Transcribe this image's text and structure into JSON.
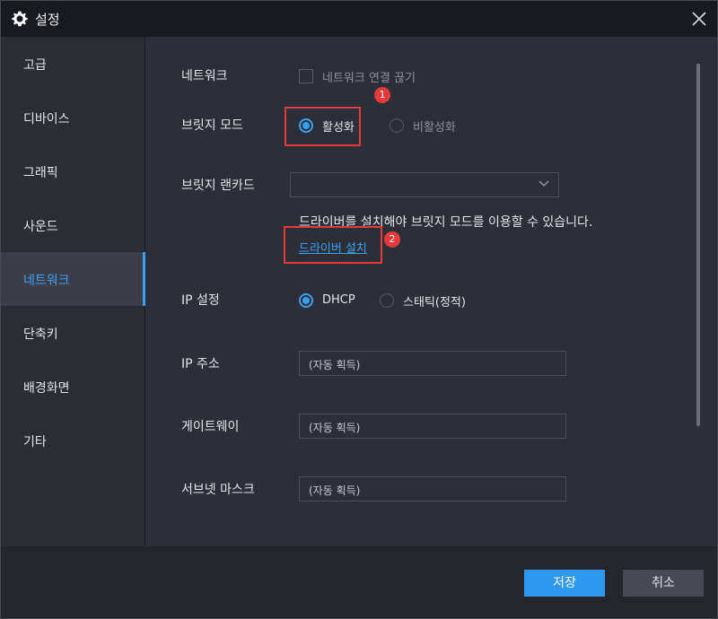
{
  "window": {
    "title": "설정"
  },
  "sidebar": {
    "items": [
      {
        "label": "고급"
      },
      {
        "label": "디바이스"
      },
      {
        "label": "그래픽"
      },
      {
        "label": "사운드"
      },
      {
        "label": "네트워크",
        "active": true
      },
      {
        "label": "단축키"
      },
      {
        "label": "배경화면"
      },
      {
        "label": "기타"
      }
    ]
  },
  "network": {
    "network_label": "네트워크",
    "disconnect_checkbox_label": "네트워크 연결 끊기",
    "disconnect_checked": false,
    "bridge_mode_label": "브릿지 모드",
    "bridge_enable_label": "활성화",
    "bridge_disable_label": "비활성화",
    "bridge_mode_selected": "활성화",
    "bridge_lancard_label": "브릿지 랜카드",
    "bridge_lancard_value": "",
    "driver_notice": "드라이버를 설치해야 브릿지 모드를 이용할 수 있습니다.",
    "driver_install_link": "드라이버 설치",
    "ip_settings_label": "IP 설정",
    "ip_dhcp_label": "DHCP",
    "ip_static_label": "스태틱(정적)",
    "ip_mode_selected": "DHCP",
    "ip_address_label": "IP 주소",
    "ip_address_value": "(자동 획득)",
    "gateway_label": "게이트웨이",
    "gateway_value": "(자동 획득)",
    "subnet_label": "서브넷 마스크",
    "subnet_value": "(자동 획득)"
  },
  "annotations": {
    "badge1": "1",
    "badge2": "2",
    "highlight_color": "#e43c3c"
  },
  "footer": {
    "save_label": "저장",
    "cancel_label": "취소"
  },
  "colors": {
    "accent": "#3aa0f5",
    "save_button": "#2e97f0",
    "background": "#2d2f38"
  }
}
